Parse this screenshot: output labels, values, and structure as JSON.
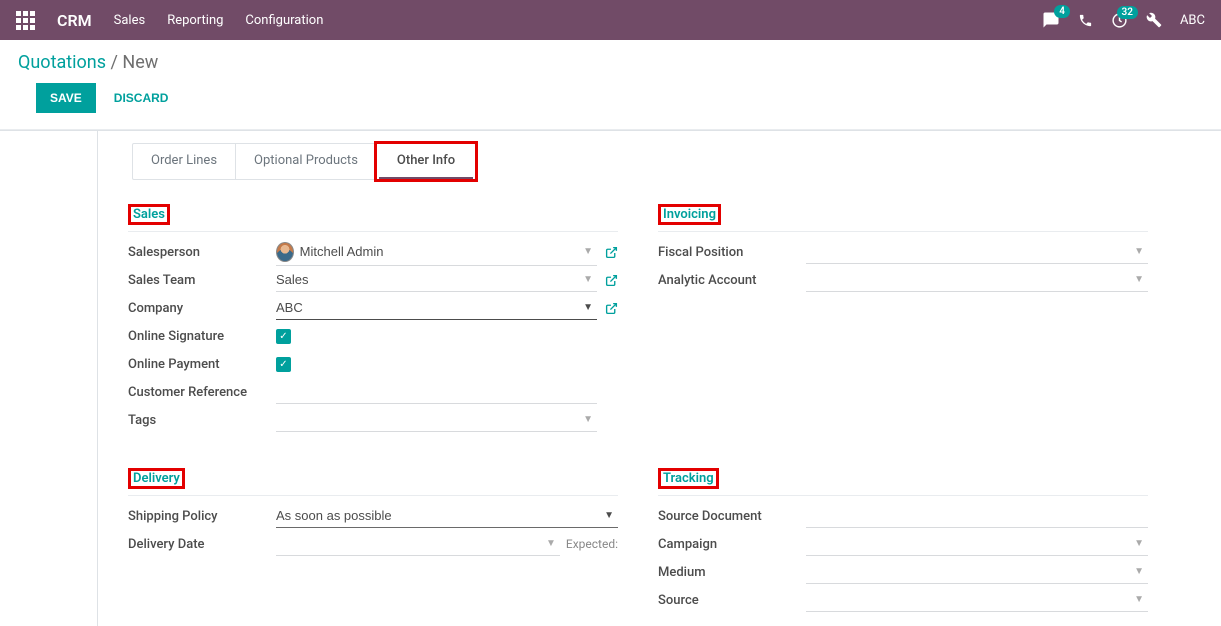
{
  "navbar": {
    "brand": "CRM",
    "menu": [
      "Sales",
      "Reporting",
      "Configuration"
    ],
    "user": "ABC",
    "chat_badge": "4",
    "clock_badge": "32"
  },
  "breadcrumb": {
    "parent": "Quotations",
    "current": "New"
  },
  "actions": {
    "save": "SAVE",
    "discard": "DISCARD"
  },
  "tabs": [
    "Order Lines",
    "Optional Products",
    "Other Info"
  ],
  "sections": {
    "sales": {
      "title": "Sales",
      "fields": {
        "salesperson": {
          "label": "Salesperson",
          "value": "Mitchell Admin"
        },
        "sales_team": {
          "label": "Sales Team",
          "value": "Sales"
        },
        "company": {
          "label": "Company",
          "value": "ABC"
        },
        "online_signature": {
          "label": "Online Signature"
        },
        "online_payment": {
          "label": "Online Payment"
        },
        "customer_reference": {
          "label": "Customer Reference",
          "value": ""
        },
        "tags": {
          "label": "Tags",
          "value": ""
        }
      }
    },
    "invoicing": {
      "title": "Invoicing",
      "fields": {
        "fiscal_position": {
          "label": "Fiscal Position",
          "value": ""
        },
        "analytic_account": {
          "label": "Analytic Account",
          "value": ""
        }
      }
    },
    "delivery": {
      "title": "Delivery",
      "fields": {
        "shipping_policy": {
          "label": "Shipping Policy",
          "value": "As soon as possible"
        },
        "delivery_date": {
          "label": "Delivery Date",
          "value": "",
          "hint": "Expected:"
        }
      }
    },
    "tracking": {
      "title": "Tracking",
      "fields": {
        "source_document": {
          "label": "Source Document",
          "value": ""
        },
        "campaign": {
          "label": "Campaign",
          "value": ""
        },
        "medium": {
          "label": "Medium",
          "value": ""
        },
        "source": {
          "label": "Source",
          "value": ""
        }
      }
    }
  }
}
